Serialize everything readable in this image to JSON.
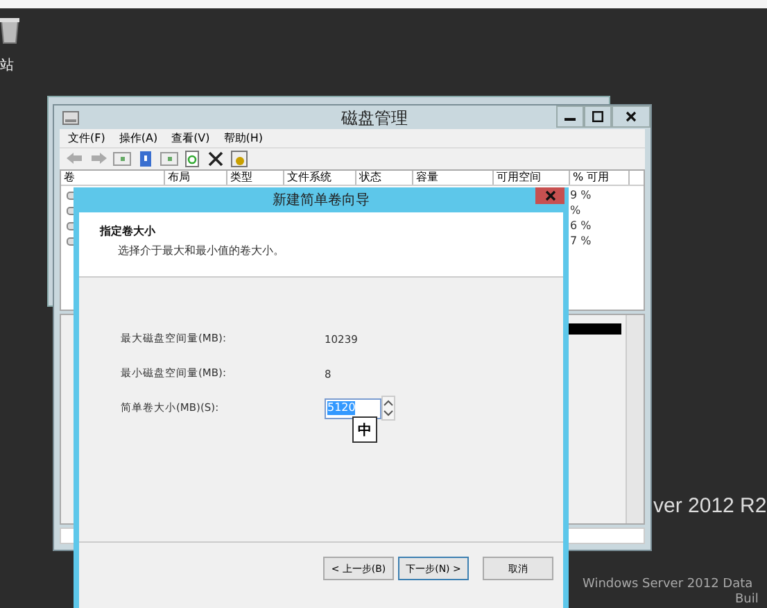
{
  "desktop": {
    "icon_label": "站",
    "brand": "ver 2012 R2",
    "edition": "Windows Server 2012 Data",
    "build": "Buil"
  },
  "disk_window": {
    "title": "磁盘管理",
    "menu": [
      "文件(F)",
      "操作(A)",
      "查看(V)",
      "帮助(H)"
    ],
    "columns": [
      "卷",
      "布局",
      "类型",
      "文件系统",
      "状态",
      "容量",
      "可用空间",
      "% 可用"
    ],
    "free_percent": [
      "9 %",
      "%",
      "6 %",
      "7 %"
    ]
  },
  "wizard": {
    "title": "新建简单卷向导",
    "heading": "指定卷大小",
    "subheading": "选择介于最大和最小值的卷大小。",
    "fields": [
      {
        "kind": "value",
        "label": "最大磁盘空间量(MB):",
        "value": "10239"
      },
      {
        "kind": "value",
        "label": "最小磁盘空间量(MB):",
        "value": "8"
      },
      {
        "kind": "spinner",
        "label": "简单卷大小(MB)(S):",
        "value": "5120"
      }
    ],
    "ime": "中",
    "buttons": [
      {
        "label": "< 上一步(B)",
        "kind": "back"
      },
      {
        "label": "下一步(N) >",
        "kind": "next"
      },
      {
        "label": "取消",
        "kind": "cancel"
      }
    ]
  }
}
